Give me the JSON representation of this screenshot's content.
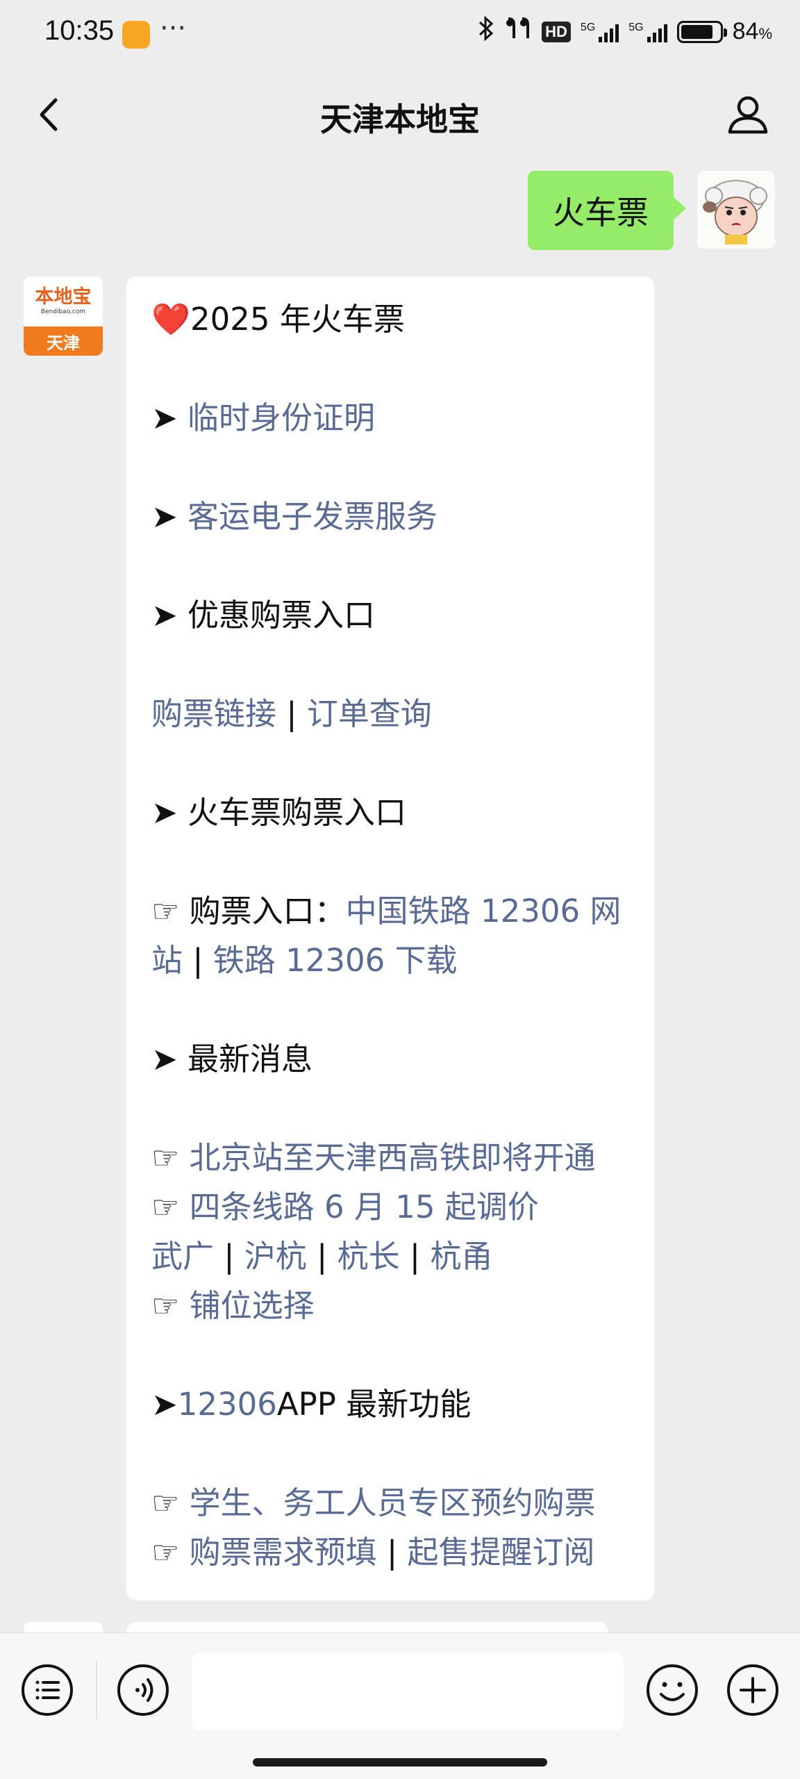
{
  "status_bar": {
    "time": "10:35",
    "dots": "···",
    "bluetooth_icon": "bluetooth-icon",
    "hd_label": "HD",
    "network_1": "5G",
    "network_2": "5G",
    "battery_percent": 84,
    "battery_text": "84",
    "battery_unit": "%"
  },
  "nav": {
    "title": "天津本地宝",
    "back_icon": "chevron-left-icon",
    "profile_icon": "person-icon"
  },
  "chat": {
    "outgoing": {
      "text": "火车票"
    },
    "bot": {
      "avatar_main": "本地宝",
      "avatar_url": "Bendibao.com",
      "avatar_city": "天津"
    },
    "message": {
      "heart": "❤️",
      "title": "2025 年火车票",
      "arrow": "➤",
      "hand": "☞",
      "sep": " | ",
      "item_temp_id": "临时身份证明",
      "item_invoice": "客运电子发票服务",
      "item_discount": "优惠购票入口",
      "link_buy": "购票链接",
      "link_order": "订单查询",
      "item_train_entry": "火车票购票入口",
      "entry_label": "购票入口：",
      "link_12306_site_a": "中国铁路 12306 网",
      "link_12306_site_b": "站",
      "link_12306_download": "铁路 12306 下载",
      "item_news": "最新消息",
      "news_1": "北京站至天津西高铁即将开通",
      "news_2": "四条线路 6 月 15 起调价",
      "route_1": "武广",
      "route_2": "沪杭",
      "route_3": "杭长",
      "route_4": "杭甬",
      "news_3": "铺位选择",
      "app_prefix": "12306",
      "app_suffix": "APP 最新功能",
      "feature_1": "学生、务工人员专区预约购票",
      "feature_2a": "购票需求预填",
      "feature_2b": "起售提醒订阅"
    }
  },
  "input_bar": {
    "menu_icon": "list-icon",
    "voice_icon": "voice-icon",
    "placeholder": "",
    "emoji_icon": "emoji-icon",
    "add_icon": "plus-icon"
  }
}
